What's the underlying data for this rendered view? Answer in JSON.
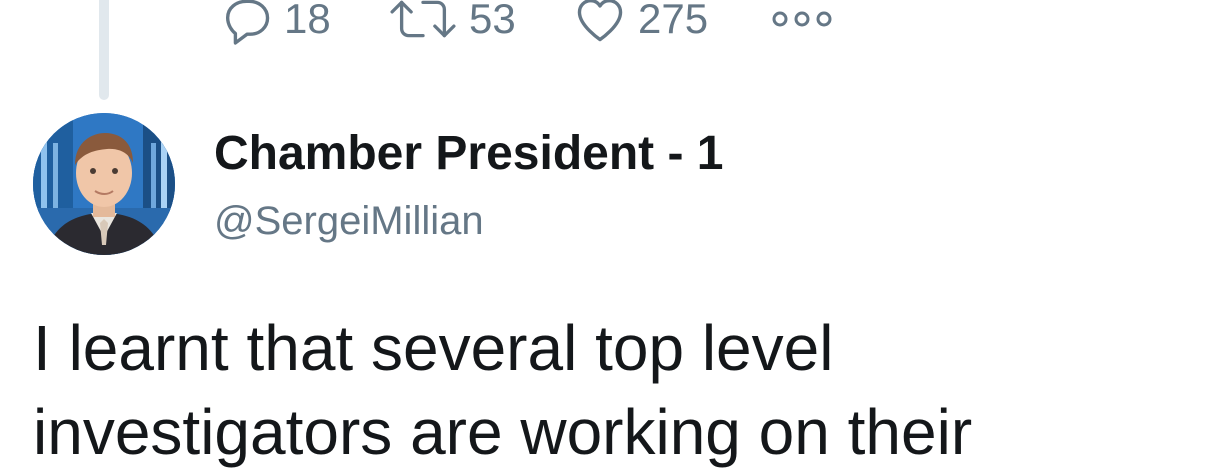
{
  "previous_tweet": {
    "actions": {
      "reply_count": "18",
      "retweet_count": "53",
      "like_count": "275"
    }
  },
  "tweet": {
    "author": {
      "display_name": "Chamber President - 1",
      "handle": "@SergeiMillian"
    },
    "text": "I learnt that several top level investigators are working on their"
  },
  "icons": {
    "reply": "reply-icon",
    "retweet": "retweet-icon",
    "like": "heart-icon",
    "more": "more-icon"
  },
  "colors": {
    "text": "#14171a",
    "muted": "#657786",
    "thread_line": "#e1e8ed"
  }
}
